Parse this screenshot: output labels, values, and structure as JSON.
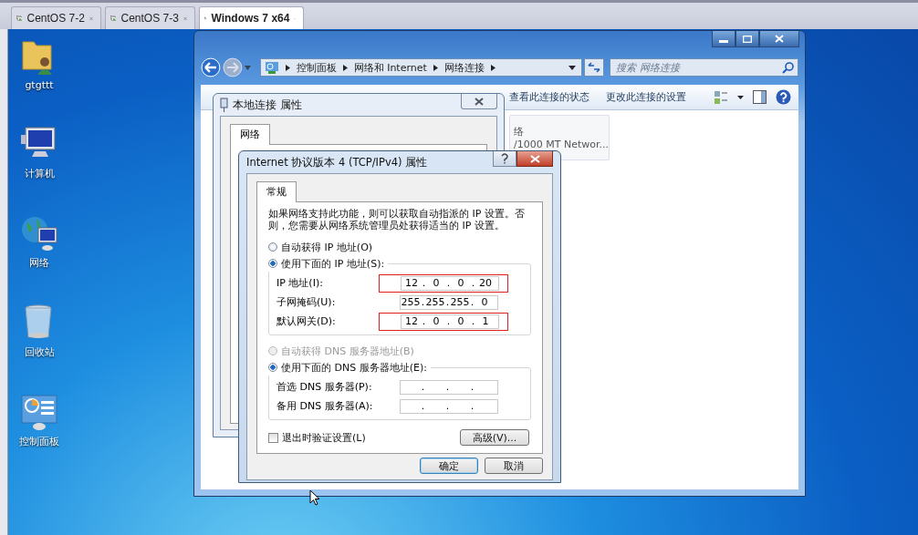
{
  "host_tabs": [
    {
      "label": "CentOS 7-2",
      "selected": false
    },
    {
      "label": "CentOS 7-3",
      "selected": false
    },
    {
      "label": "Windows 7 x64",
      "selected": true
    }
  ],
  "desktop_icons": [
    {
      "kind": "user-folder",
      "label": "gtgttt"
    },
    {
      "kind": "computer",
      "label": "计算机"
    },
    {
      "kind": "network",
      "label": "网络"
    },
    {
      "kind": "recycle-bin",
      "label": "回收站"
    },
    {
      "kind": "control-panel",
      "label": "控制面板"
    }
  ],
  "explorer": {
    "breadcrumbs": [
      "控制面板",
      "网络和 Internet",
      "网络连接"
    ],
    "search": {
      "placeholder": "搜索 网络连接"
    },
    "toolbar": [
      "查看此连接的状态",
      "更改此连接的设置"
    ],
    "adapter": {
      "lines": [
        "络",
        "/1000 MT Networ..."
      ]
    }
  },
  "local_props": {
    "title": "本地连接 属性",
    "tabs": [
      {
        "label": "网络",
        "selected": true
      }
    ]
  },
  "ipv4": {
    "title": "Internet 协议版本 4 (TCP/IPv4) 属性",
    "tabs": [
      {
        "label": "常规",
        "selected": true
      }
    ],
    "description": "如果网络支持此功能，则可以获取自动指派的 IP 设置。否则，您需要从网络系统管理员处获得适当的 IP 设置。",
    "octet_separator": ".",
    "ip_mode": [
      {
        "label": "自动获得 IP 地址(O)",
        "selected": false,
        "disabled": false
      },
      {
        "label": "使用下面的 IP 地址(S):",
        "selected": true,
        "disabled": false
      }
    ],
    "ip_fields": [
      {
        "label": "IP 地址(I):",
        "octets": [
          "12",
          "0",
          "0",
          "20"
        ],
        "highlighted": true
      },
      {
        "label": "子网掩码(U):",
        "octets": [
          "255",
          "255",
          "255",
          "0"
        ],
        "highlighted": false
      },
      {
        "label": "默认网关(D):",
        "octets": [
          "12",
          "0",
          "0",
          "1"
        ],
        "highlighted": true
      }
    ],
    "dns_mode": [
      {
        "label": "自动获得 DNS 服务器地址(B)",
        "selected": false,
        "disabled": true
      },
      {
        "label": "使用下面的 DNS 服务器地址(E):",
        "selected": true,
        "disabled": false
      }
    ],
    "dns_fields": [
      {
        "label": "首选 DNS 服务器(P):",
        "highlighted": false
      },
      {
        "label": "备用 DNS 服务器(A):",
        "highlighted": false
      }
    ],
    "validate_on_exit": {
      "label": "退出时验证设置(L)",
      "checked": false
    },
    "advanced_button": "高级(V)...",
    "buttons": [
      {
        "label": "确定",
        "kind": "default"
      },
      {
        "label": "取消",
        "kind": "normal"
      }
    ]
  }
}
